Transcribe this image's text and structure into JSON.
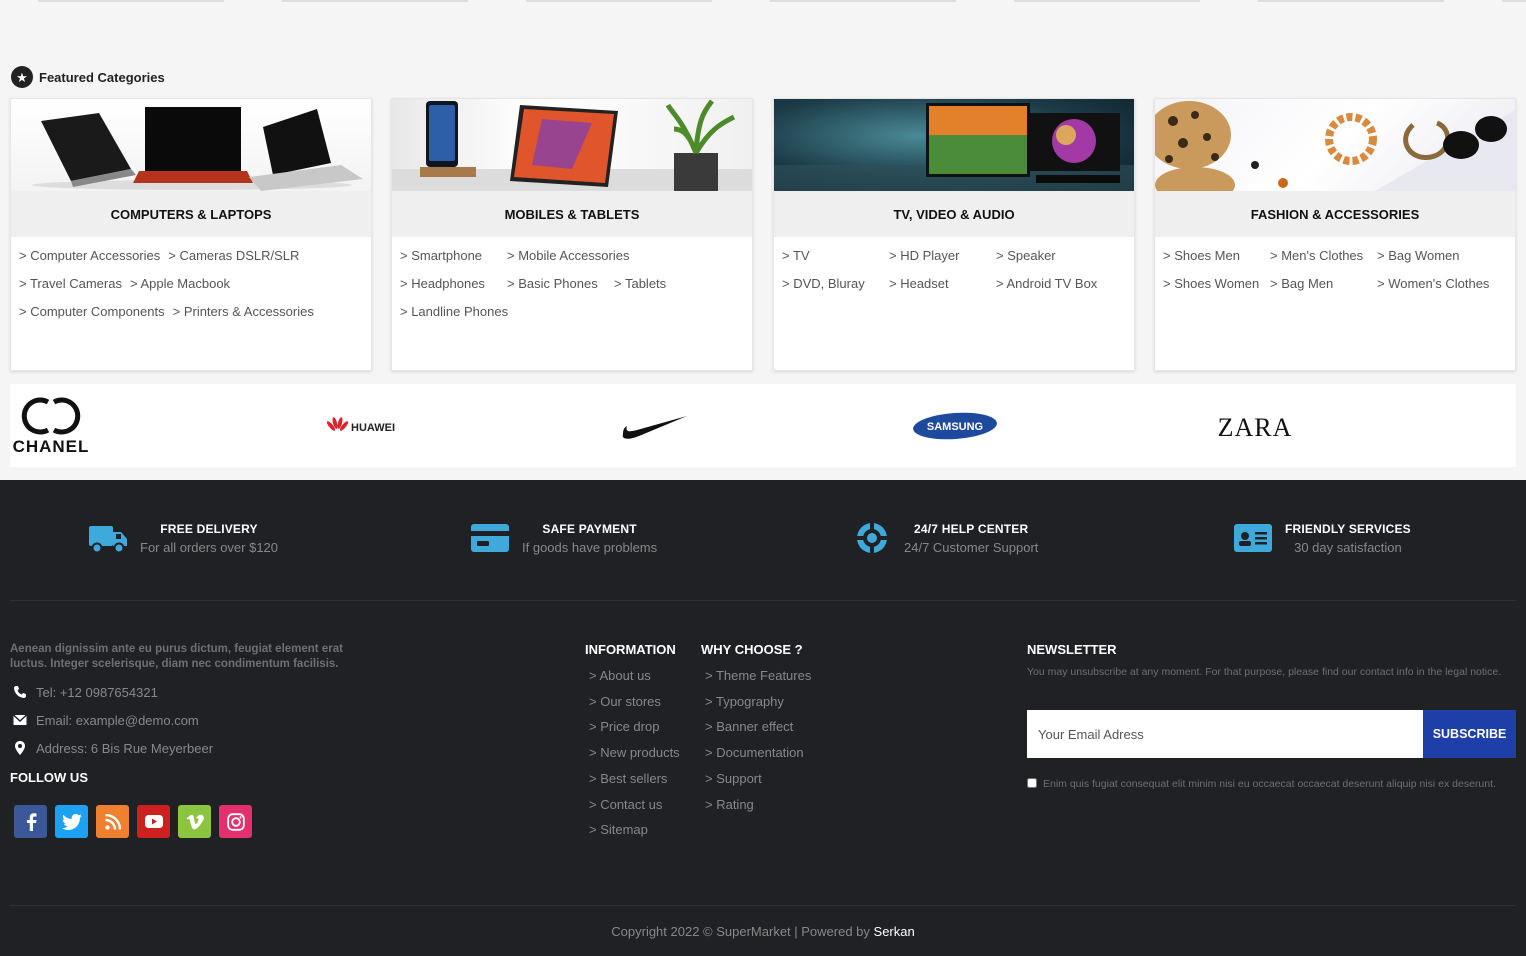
{
  "featured": {
    "title": "Featured Categories",
    "icon": "star-icon"
  },
  "categories": [
    {
      "title": "COMPUTERS & LAPTOPS",
      "links": [
        "> Computer Accessories",
        "> Cameras DSLR/SLR",
        "> Travel Cameras",
        "> Apple Macbook",
        "> Computer Components",
        "> Printers & Accessories"
      ]
    },
    {
      "title": "MOBILES & TABLETS",
      "links": [
        "> Smartphone",
        "> Mobile Accessories",
        "> Headphones",
        "> Basic Phones",
        "> Tablets",
        "> Landline Phones"
      ]
    },
    {
      "title": "TV, VIDEO & AUDIO",
      "links": [
        "> TV",
        "> HD Player",
        "> Speaker",
        "> DVD, Bluray",
        "> Headset",
        "> Android TV Box"
      ]
    },
    {
      "title": "FASHION & ACCESSORIES",
      "links": [
        "> Shoes Men",
        "> Men's Clothes",
        "> Bag Women",
        "> Shoes Women",
        "> Bag Men",
        "> Women's Clothes"
      ]
    }
  ],
  "brands": [
    "CHANEL",
    "HUAWEI",
    "Nike",
    "SAMSUNG",
    "ZARA"
  ],
  "services": [
    {
      "title": "FREE DELIVERY",
      "subtitle": "For all orders over $120",
      "icon": "truck-icon"
    },
    {
      "title": "SAFE PAYMENT",
      "subtitle": "If goods have problems",
      "icon": "credit-card-icon"
    },
    {
      "title": "24/7 HELP CENTER",
      "subtitle": "24/7 Customer Support",
      "icon": "lifebuoy-icon"
    },
    {
      "title": "FRIENDLY SERVICES",
      "subtitle": "30 day satisfaction",
      "icon": "id-card-icon"
    }
  ],
  "about": {
    "text": "Aenean dignissim ante eu purus dictum, feugiat element erat luctus. Integer scelerisque, diam nec condimentum facilisis.",
    "phone": "Tel: +12 0987654321",
    "email": "Email: example@demo.com",
    "address": "Address: 6 Bis Rue Meyerbeer"
  },
  "follow": {
    "title": "FOLLOW US",
    "networks": [
      "facebook",
      "twitter",
      "rss",
      "youtube",
      "vimeo",
      "instagram"
    ]
  },
  "information": {
    "title": "INFORMATION",
    "links": [
      "> About us",
      "> Our stores",
      "> Price drop",
      "> New products",
      "> Best sellers",
      "> Contact us",
      "> Sitemap"
    ]
  },
  "why_choose": {
    "title": "WHY CHOOSE ?",
    "links": [
      "> Theme Features",
      "> Typography",
      "> Banner effect",
      "> Documentation",
      "> Support",
      "> Rating"
    ]
  },
  "newsletter": {
    "title": "NEWSLETTER",
    "text": "You may unsubscribe at any moment. For that purpose, please find our contact info in the legal notice.",
    "placeholder": "Your Email Adress",
    "button": "SUBSCRIBE",
    "consent": "Enim quis fugiat consequat elit minim nisi eu occaecat occaecat deserunt aliquip nisi ex deserunt."
  },
  "copyright": {
    "text": "Copyright 2022 © SuperMarket | Powered by ",
    "author": "Serkan"
  },
  "colors": {
    "footer_bg": "#1f2125",
    "accent_blue": "#1e3fa8",
    "service_icon": "#3fa9dc"
  }
}
